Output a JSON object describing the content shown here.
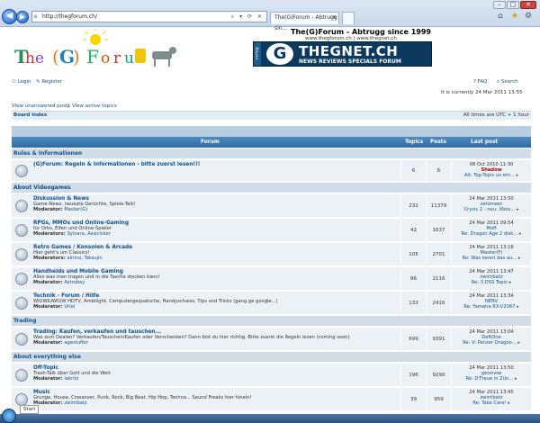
{
  "browser": {
    "address": "http://thegforum.ch/",
    "tabs": [
      {
        "label": "The(G)Forum - Abtrugg sin..."
      }
    ],
    "window_controls": [
      "–",
      "□",
      "✕"
    ]
  },
  "site": {
    "logo_text": "The (G) Forum",
    "tagline": "The(G)Forum - Abtrugg since 1999",
    "links_line": "www.thegforum.ch | www.thegnet.ch",
    "banner_title": "THEGNET.CH",
    "banner_sub": "NEWS REVIEWS SPECIALS FORUM",
    "banner_side": "verlag"
  },
  "header": {
    "login": "Login",
    "register": "Register",
    "faq": "FAQ",
    "search": "Search",
    "current_time": "It is currently 24 Mar 2011 13:55",
    "view_unanswered": "View unanswered posts",
    "view_active": "View active topics",
    "breadcrumb": "Board index",
    "timezone": "All times are UTC + 1 hour"
  },
  "table": {
    "headers": {
      "forum": "Forum",
      "topics": "Topics",
      "posts": "Posts",
      "last_post": "Last post"
    }
  },
  "categories": [
    {
      "name": "Rules & Informationen",
      "forums": [
        {
          "name": "(G)Forum: Regeln & Informationen - bitte zuerst lesen!!!",
          "desc": "",
          "mod_label": "",
          "moderator": "",
          "topics": "6",
          "posts": "6",
          "lp_date": "08 Oct 2010 11:30",
          "lp_user": "Shadow",
          "lp_topic": "Alt: Top-Topic us em..."
        }
      ]
    },
    {
      "name": "About Videogames",
      "forums": [
        {
          "name": "Diskussion & News",
          "desc": "Game-News, neueste Gerüchte, Spiele-Talk!",
          "mod_label": "Moderator:",
          "moderator": "Master(G)",
          "topics": "232",
          "posts": "11379",
          "lp_date": "24 Mar 2011 13:50",
          "lp_user": "zeromeer",
          "lp_topic": "Crysis 2 - neu: Xbox..."
        },
        {
          "name": "RPGs, MMOs und Online-Gaming",
          "desc": "für Orks, Elfen und Online-Spieler",
          "mod_label": "Moderators:",
          "moderator": "Sylvara, Assicicker",
          "topics": "42",
          "posts": "1637",
          "lp_date": "24 Mar 2011 09:54",
          "lp_user": "Moff",
          "lp_topic": "Re: Dragon Age 2 disk..."
        },
        {
          "name": "Retro Games / Konsolen & Arcade",
          "desc": "Hier geht's um Classics!",
          "mod_label": "Moderators:",
          "moderator": "alnino, Tatoujin",
          "topics": "105",
          "posts": "2701",
          "lp_date": "24 Mar 2011 13:18",
          "lp_user": "Master(F)",
          "lp_topic": "Re: Was kennt das au..."
        },
        {
          "name": "Handhelds und Mobile Gaming",
          "desc": "Alles was man tragen und in die Tasche stecken kann!",
          "mod_label": "Moderator:",
          "moderator": "Astroboy",
          "topics": "86",
          "posts": "2116",
          "lp_date": "24 Mar 2011 13:47",
          "lp_user": "zwirribatz",
          "lp_topic": "Re: 3 DSS Topic"
        },
        {
          "name": "Technik - Forum / Hilfe",
          "desc": "WIUWIUWIUW HDTV, Ambilight, Computergequatsche, Handyschaiss, Tips und Tricks (gang ge google...)",
          "mod_label": "Moderator:",
          "moderator": "Uriel",
          "topics": "133",
          "posts": "2416",
          "lp_date": "24 Mar 2011 13:34",
          "lp_user": "NERV",
          "lp_topic": "Re: Yamaha RX-V2067"
        }
      ]
    },
    {
      "name": "Trading",
      "forums": [
        {
          "name": "Trading: Kaufen, verkaufen und tauschen...",
          "desc": "Was zum Dealen? Verkaufen/Tauschen/Kaufen oder Verschenken? Dann bist du hier richtig. Bitte zuerst die Regeln lesen (coming soon)",
          "mod_label": "Moderator:",
          "moderator": "agestuffer",
          "topics": "699",
          "posts": "9391",
          "lp_date": "24 Mar 2011 13:04",
          "lp_user": "DeftOne",
          "lp_topic": "Re: V: Panzer Dragoo..."
        }
      ]
    },
    {
      "name": "About everything else",
      "forums": [
        {
          "name": "Off-Topic",
          "desc": "Trash-Talk über Gott und die Welt",
          "mod_label": "Moderator:",
          "moderator": "lakritz",
          "topics": "196",
          "posts": "9290",
          "lp_date": "24 Mar 2011 13:50",
          "lp_user": "gessnow",
          "lp_topic": "Re: D'Freue in Zün..."
        },
        {
          "name": "Music",
          "desc": "Grunge, House, Crossover, Punk, Rock, Big Beat, Hip Hop, Techno... Sound Freaks hier hinein!",
          "mod_label": "Moderator:",
          "moderator": "zwirribatz",
          "topics": "39",
          "posts": "959",
          "lp_date": "24 Mar 2011 13:45",
          "lp_user": "zwirribatz",
          "lp_topic": "Re: Take Care!"
        }
      ]
    }
  ],
  "taskbar": {
    "start_tooltip": "Start"
  }
}
